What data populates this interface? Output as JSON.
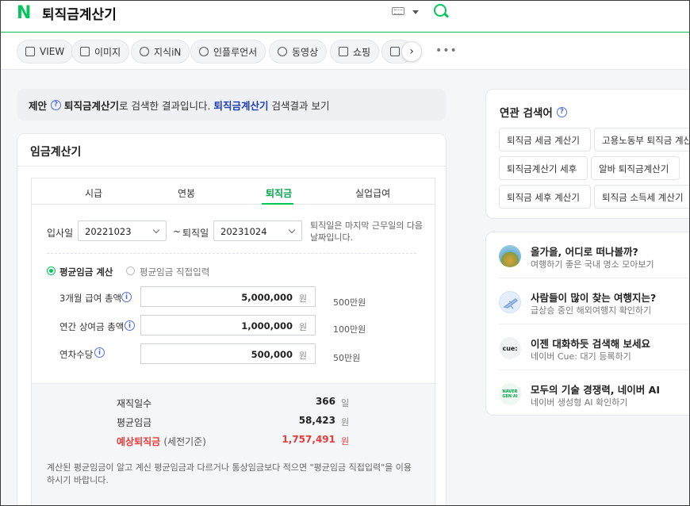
{
  "header": {
    "logo": "N",
    "query": "퇴직금계산기"
  },
  "tabs": [
    {
      "label": "VIEW",
      "icon": "document-icon"
    },
    {
      "label": "이미지",
      "icon": "image-icon"
    },
    {
      "label": "지식iN",
      "icon": "question-icon"
    },
    {
      "label": "인플루언서",
      "icon": "person-icon"
    },
    {
      "label": "동영상",
      "icon": "play-icon"
    },
    {
      "label": "쇼핑",
      "icon": "bag-icon"
    },
    {
      "label": "",
      "icon": "news-icon"
    }
  ],
  "suggestion": {
    "prefix": "제안",
    "query": "퇴직금계산기",
    "middle": "로 검색한 결과입니다.",
    "link": "퇴직금계산기",
    "suffix": "검색결과 보기"
  },
  "calculator": {
    "title": "임금계산기",
    "tabs": [
      "시급",
      "연봉",
      "퇴직금",
      "실업급여"
    ],
    "active_tab": "퇴직금",
    "start_label": "입사일",
    "start_value": "20221023",
    "tilde": "~",
    "end_label": "퇴직일",
    "end_value": "20231024",
    "note": "퇴직일은 마지막 근무일의 다음 날짜입니다.",
    "radio_avg": "평균임금 계산",
    "radio_direct": "평균임금 직접입력",
    "fields": [
      {
        "label": "3개월 급여 총액",
        "value": "5,000,000",
        "unit": "원",
        "hint": "500만원"
      },
      {
        "label": "연간 상여금 총액",
        "value": "1,000,000",
        "unit": "원",
        "hint": "100만원"
      },
      {
        "label": "연차수당",
        "value": "500,000",
        "unit": "원",
        "hint": "50만원"
      }
    ],
    "results": [
      {
        "label": "재직일수",
        "value": "366",
        "unit": "일"
      },
      {
        "label": "평균임금",
        "value": "58,423",
        "unit": "원"
      },
      {
        "label": "예상퇴직금",
        "sub": "(세전기준)",
        "value": "1,757,491",
        "unit": "원"
      }
    ],
    "result_note": "계산된 평균임금이 알고 계신 평균임금과 다르거나 통상임금보다 적으면 \"평균임금 직접입력\"을 이용하시기 바랍니다."
  },
  "related": {
    "title": "연관 검색어",
    "chips": [
      "퇴직금 세금 계산기",
      "고용노동부 퇴직금 계산기",
      "퇴직금계산기 세후",
      "알바 퇴직금계산기",
      "퇴직금 세후 계산기",
      "퇴직금 소득세 계산기"
    ]
  },
  "promos": [
    {
      "title": "올가을, 어디로 떠나볼까?",
      "sub": "여행하기 좋은 국내 명소 모아보기"
    },
    {
      "title": "사람들이 많이 찾는 여행지는?",
      "sub": "급상승 중인 해외여행지 확인하기"
    },
    {
      "title": "이젠 대화하듯 검색해 보세요",
      "sub": "네이버 Cue: 대기 등록하기",
      "badge": "cue:"
    },
    {
      "title": "모두의 기술 경쟁력, 네이버 AI",
      "sub": "네이버 생성형 AI 확인하기",
      "badge": "NAVER GEN AI"
    }
  ],
  "colors": {
    "brand": "#03c75a",
    "link": "#1d3fb2",
    "alert": "#e83a3a"
  }
}
